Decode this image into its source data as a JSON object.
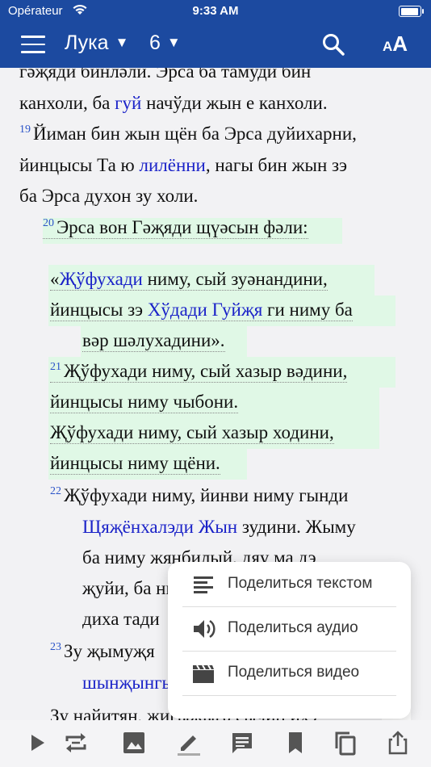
{
  "status": {
    "carrier": "Opérateur",
    "time": "9:33 AM"
  },
  "header": {
    "book": "Лука",
    "chapter": "6",
    "dropdown_arrow": "▼",
    "font_size_small": "A",
    "font_size_large": "A"
  },
  "content": {
    "lines": [
      {
        "text": "гәҗяди бинләли. Эрса ба тамуди бин"
      },
      {
        "pre": "канхоли, ба ",
        "link": "гуй",
        "post": " начўди жын е канхоли."
      },
      {
        "num": "19",
        "text": "Йиман бин жын щён ба Эрса дуйихарни,"
      },
      {
        "pre": "йинцысы Та ю ",
        "link": "лилённи",
        "post": ", нагы бин жын зэ"
      },
      {
        "text": "ба Эрса духон зу холи."
      },
      {
        "num": "20",
        "text": "Эрса вон Гәҗяди щүәсын фәли:"
      },
      {
        "pre": "«",
        "link": "Җўфухади",
        "post": " ниму, сый зуәнандини,"
      },
      {
        "pre": "йинцысы зэ ",
        "link": "Хўдади Гуйҗя",
        "post": " ги ниму ба"
      },
      {
        "text": "вәр шәлухадини»."
      },
      {
        "num": "21",
        "text": "Җўфухади ниму, сый хазыр вәдини,"
      },
      {
        "text": "йинцысы ниму чыбони."
      },
      {
        "text": "Җўфухади ниму, сый хазыр ходини,"
      },
      {
        "text": "йинцысы ниму щёни."
      },
      {
        "num": "22",
        "text": "Җўфухади ниму, йинви ниму гынди"
      },
      {
        "link": "Щяҗёнхалэди Жын",
        "post": " зудини. Жыму"
      },
      {
        "text": "ба ниму жянбилый, дяу ма дэ"
      },
      {
        "text": "җуйи, ба ни"
      },
      {
        "text": "диха тади"
      },
      {
        "num": "23",
        "text": "Зу җымуҗя"
      },
      {
        "link": "шынҗынгы"
      },
      {
        "text": "Зу найитян, жигыҗыгә сычин ихэ"
      }
    ]
  },
  "share_menu": {
    "items": [
      {
        "label": "Поделиться текстом",
        "icon": "text-lines-icon"
      },
      {
        "label": "Поделиться аудио",
        "icon": "speaker-icon"
      },
      {
        "label": "Поделиться видео",
        "icon": "clapperboard-icon"
      }
    ]
  },
  "toolbar": {
    "icons": [
      "play-icon",
      "repeat-icon",
      "image-icon",
      "pencil-icon",
      "note-icon",
      "bookmark-icon",
      "copy-icon",
      "share-icon"
    ]
  }
}
